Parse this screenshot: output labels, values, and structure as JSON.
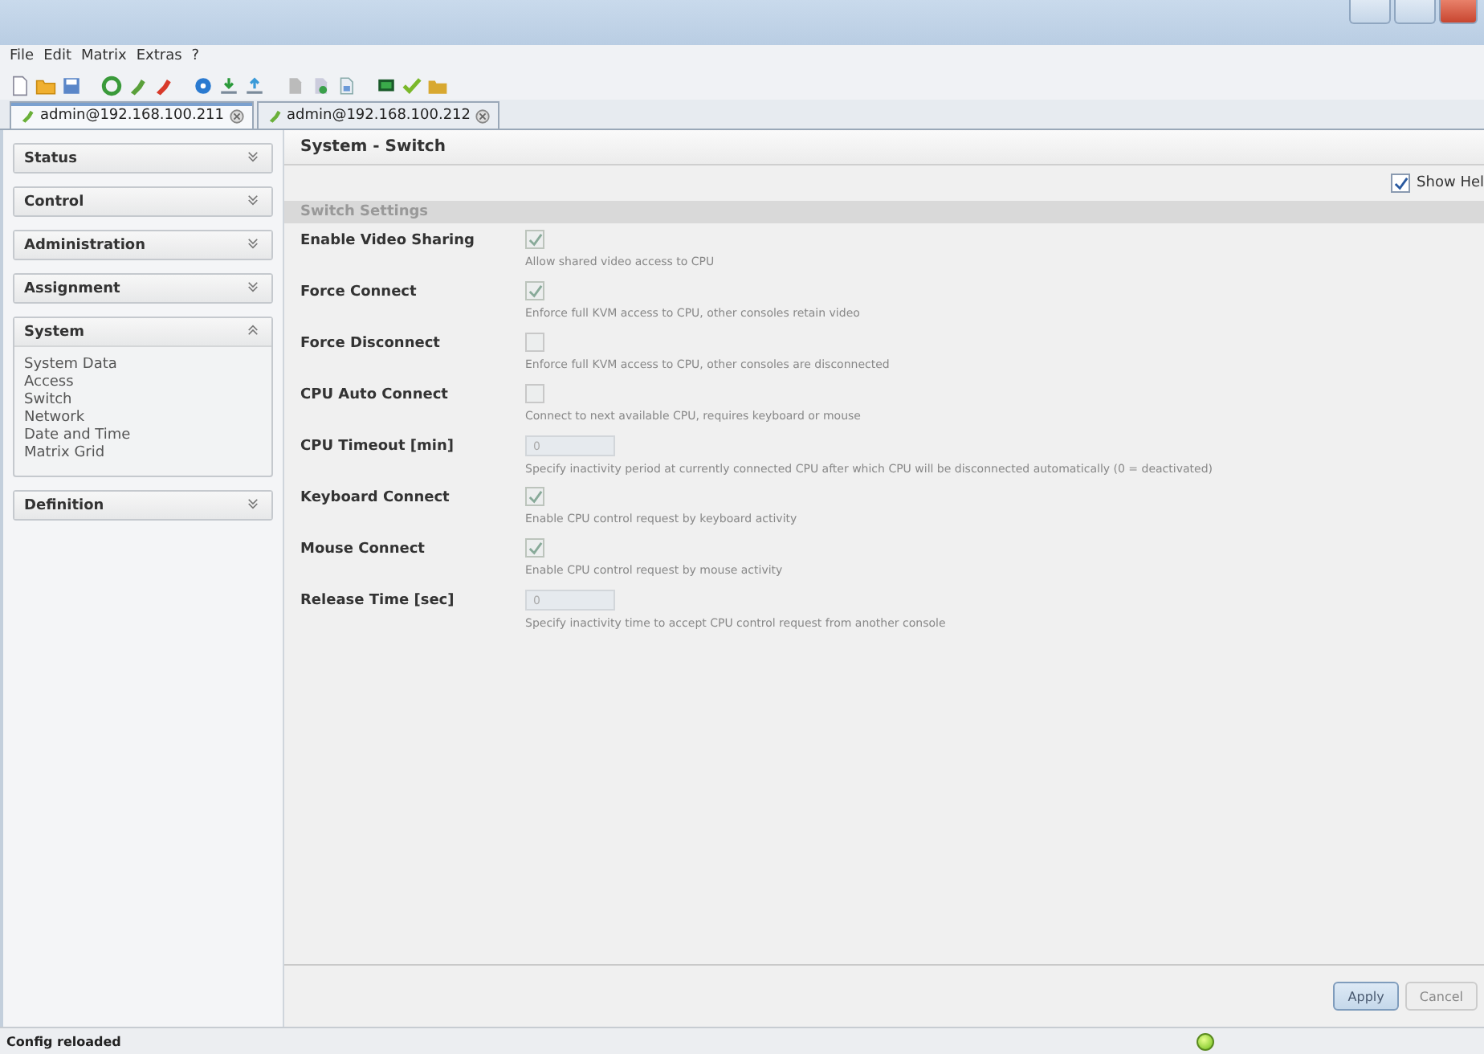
{
  "menu": [
    "File",
    "Edit",
    "Matrix",
    "Extras",
    "?"
  ],
  "tabs": [
    {
      "label": "admin@192.168.100.211",
      "selected": true
    },
    {
      "label": "admin@192.168.100.212",
      "selected": false
    }
  ],
  "sidebar": [
    {
      "label": "Status",
      "expanded": false
    },
    {
      "label": "Control",
      "expanded": false
    },
    {
      "label": "Administration",
      "expanded": false
    },
    {
      "label": "Assignment",
      "expanded": false
    },
    {
      "label": "System",
      "expanded": true,
      "children": [
        "System Data",
        "Access",
        "Switch",
        "Network",
        "Date and Time",
        "Matrix Grid"
      ]
    },
    {
      "label": "Definition",
      "expanded": false
    }
  ],
  "page_title": "System - Switch",
  "show_help": {
    "label": "Show Hel",
    "checked": true
  },
  "section_title": "Switch Settings",
  "settings": [
    {
      "kind": "checkbox",
      "label": "Enable Video Sharing",
      "checked": true,
      "hint": "Allow shared video access to CPU"
    },
    {
      "kind": "checkbox",
      "label": "Force Connect",
      "checked": true,
      "hint": "Enforce full KVM access to CPU, other consoles retain video"
    },
    {
      "kind": "checkbox",
      "label": "Force Disconnect",
      "checked": false,
      "hint": "Enforce full KVM access to CPU, other consoles are disconnected"
    },
    {
      "kind": "checkbox",
      "label": "CPU Auto Connect",
      "checked": false,
      "hint": "Connect to next available CPU, requires keyboard or mouse"
    },
    {
      "kind": "number",
      "label": "CPU Timeout [min]",
      "value": "0",
      "hint": "Specify inactivity period at currently connected CPU after which CPU will be disconnected automatically (0 = deactivated)"
    },
    {
      "kind": "checkbox",
      "label": "Keyboard Connect",
      "checked": true,
      "hint": "Enable CPU control request by keyboard activity"
    },
    {
      "kind": "checkbox",
      "label": "Mouse Connect",
      "checked": true,
      "hint": "Enable CPU control request by mouse activity"
    },
    {
      "kind": "number",
      "label": "Release Time [sec]",
      "value": "0",
      "hint": "Specify inactivity time to accept CPU control request from another console"
    }
  ],
  "buttons": [
    "Apply",
    "Cancel"
  ],
  "status_bar": {
    "message": "Config reloaded",
    "connected": true
  }
}
